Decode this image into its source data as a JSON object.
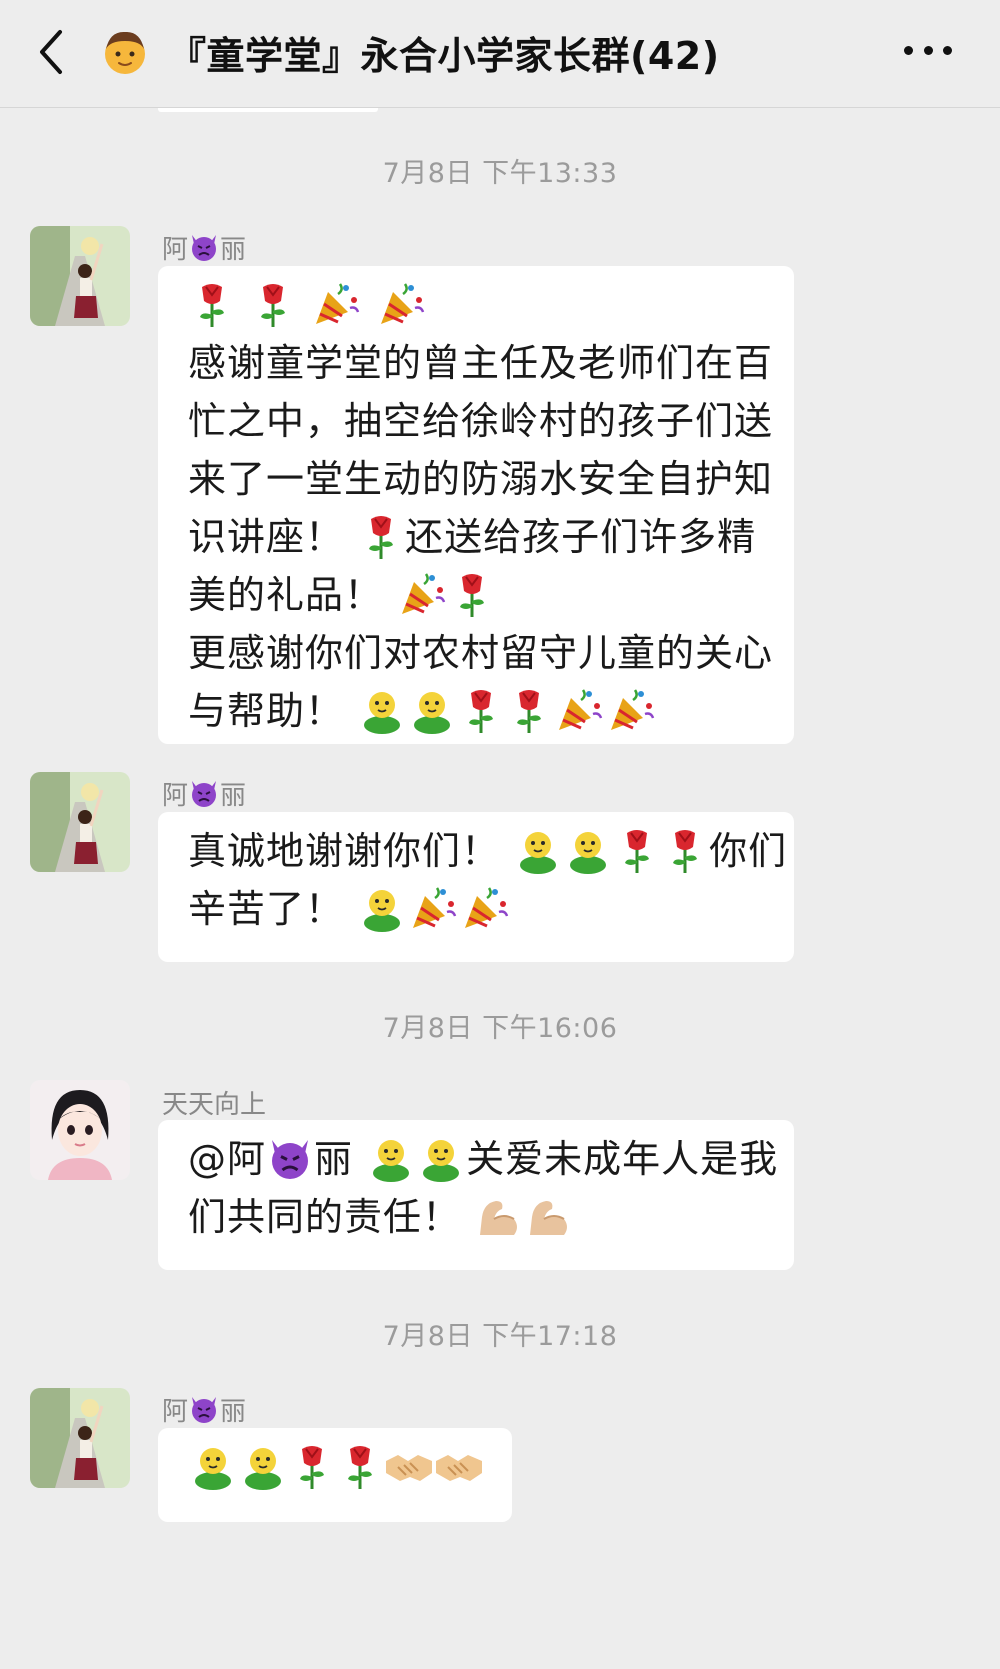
{
  "header": {
    "title": "『童学堂』永合小学家长群(42)",
    "back_icon": "chevron-left-icon",
    "more_icon": "more-dots-icon",
    "title_emoji": "boy-emoji"
  },
  "timestamps": [
    "7月8日 下午13:33",
    "7月8日 下午16:06",
    "7月8日 下午17:18"
  ],
  "messages": [
    {
      "sender_prefix": "阿",
      "sender_suffix": "丽",
      "sender_emoji": "angry-devil-emoji",
      "lines": [
        "感谢童学堂的曾主任及老师们在百",
        "忙之中，抽空给徐岭村的孩子们送",
        "来了一堂生动的防溺水安全自护知",
        "识讲座！",
        "还送给孩子们许多精",
        "美的礼品！",
        "更感谢你们对农村留守儿童的关心",
        "与帮助！"
      ]
    },
    {
      "sender_prefix": "阿",
      "sender_suffix": "丽",
      "sender_emoji": "angry-devil-emoji",
      "lines": [
        "真诚地谢谢你们！",
        "你们",
        "辛苦了！"
      ]
    },
    {
      "sender": "天天向上",
      "lines": [
        "@阿",
        "丽",
        "关爱未成年人是我",
        "们共同的责任！"
      ]
    },
    {
      "sender_prefix": "阿",
      "sender_suffix": "丽",
      "sender_emoji": "angry-devil-emoji",
      "lines": []
    }
  ],
  "colors": {
    "background": "#ededed",
    "bubble": "#ffffff",
    "timestamp": "#9b9b9b",
    "sender": "#888888",
    "rose": "#d9262e",
    "figure": "#3aa535",
    "devil": "#8e44c9"
  }
}
